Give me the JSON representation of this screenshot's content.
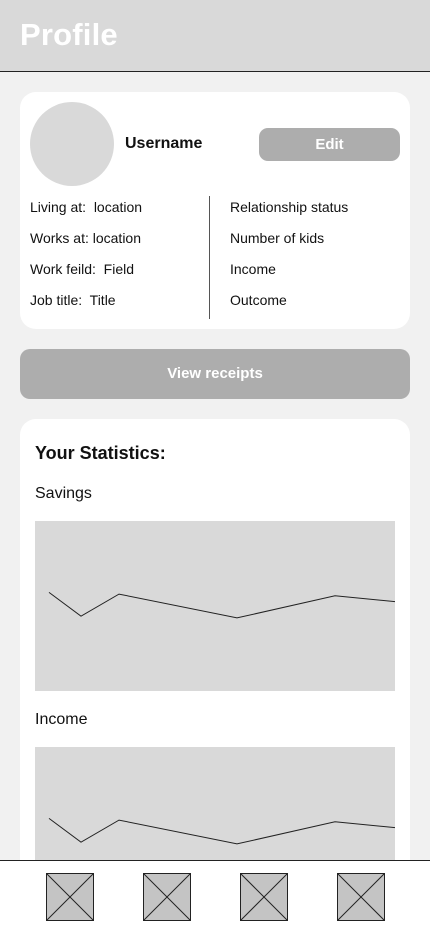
{
  "header": {
    "title": "Profile"
  },
  "profile": {
    "username": "Username",
    "edit_label": "Edit",
    "left_info": [
      "Living at:  location",
      "Works at: location",
      "Work feild:  Field",
      "Job title:  Title"
    ],
    "right_info": [
      "Relationship status",
      "Number of kids",
      "Income",
      "Outcome"
    ]
  },
  "receipts": {
    "label": "View receipts"
  },
  "statistics": {
    "title": "Your Statistics:",
    "charts": [
      {
        "label": "Savings"
      },
      {
        "label": "Income"
      }
    ]
  },
  "chart_data": [
    {
      "type": "line",
      "title": "Savings",
      "x": [
        1,
        2,
        3,
        4,
        5,
        6,
        7
      ],
      "series": [
        {
          "values": [
            0.58,
            0.44,
            0.57,
            0.43,
            0.56,
            0.52,
            0.44
          ]
        }
      ],
      "grid": false
    },
    {
      "type": "line",
      "title": "Income",
      "x": [
        1,
        2,
        3,
        4,
        5,
        6,
        7
      ],
      "series": [
        {
          "values": [
            0.58,
            0.44,
            0.57,
            0.43,
            0.56,
            0.52,
            0.44
          ]
        }
      ],
      "grid": false
    }
  ],
  "nav": {
    "items": [
      {
        "icon": "placeholder-icon"
      },
      {
        "icon": "placeholder-icon"
      },
      {
        "icon": "placeholder-icon"
      },
      {
        "icon": "placeholder-icon"
      }
    ]
  },
  "colors": {
    "background": "#f1f1f1",
    "panel": "#d9d9d9",
    "button": "#adadad",
    "card": "#ffffff"
  }
}
